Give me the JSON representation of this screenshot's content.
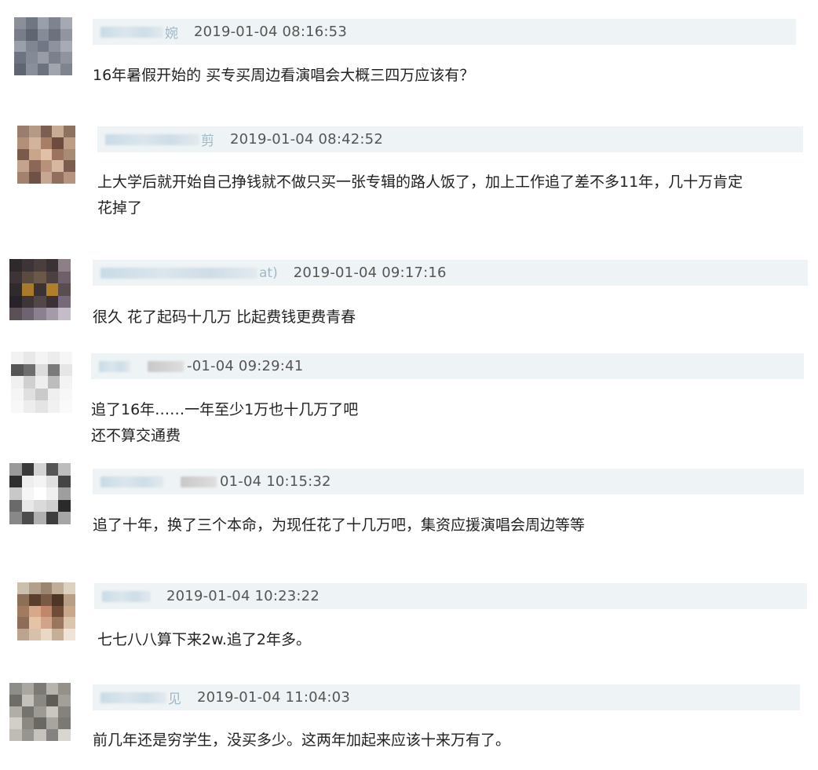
{
  "comments": [
    {
      "name_visible": "婉",
      "time": "2019-01-04 08:16:53",
      "lines": [
        "16年暑假开始的 买专买周边看演唱会大概三四万应该有？"
      ]
    },
    {
      "name_visible": "剪",
      "time": "2019-01-04 08:42:52",
      "lines": [
        "上大学后就开始自己挣钱就不做只买一张专辑的路人饭了，加上工作追了差不多11年，几十万肯定",
        "花掉了"
      ]
    },
    {
      "name_visible": "at)",
      "time": "2019-01-04 09:17:16",
      "lines": [
        "很久 花了起码十几万 比起费钱更费青春"
      ]
    },
    {
      "name_visible": "",
      "time": "-01-04 09:29:41",
      "lines": [
        "追了16年……一年至少1万也十几万了吧",
        "还不算交通费"
      ]
    },
    {
      "name_visible": "",
      "time": "01-04 10:15:32",
      "lines": [
        "追了十年，换了三个本命，为现任花了十几万吧，集资应援演唱会周边等等"
      ]
    },
    {
      "name_visible": "",
      "time": "2019-01-04 10:23:22",
      "lines": [
        "七七八八算下来2w.追了2年多。"
      ]
    },
    {
      "name_visible": "见",
      "time": "2019-01-04 11:04:03",
      "lines": [
        "前几年还是穷学生，没买多少。这两年加起来应该十来万有了。"
      ]
    }
  ]
}
